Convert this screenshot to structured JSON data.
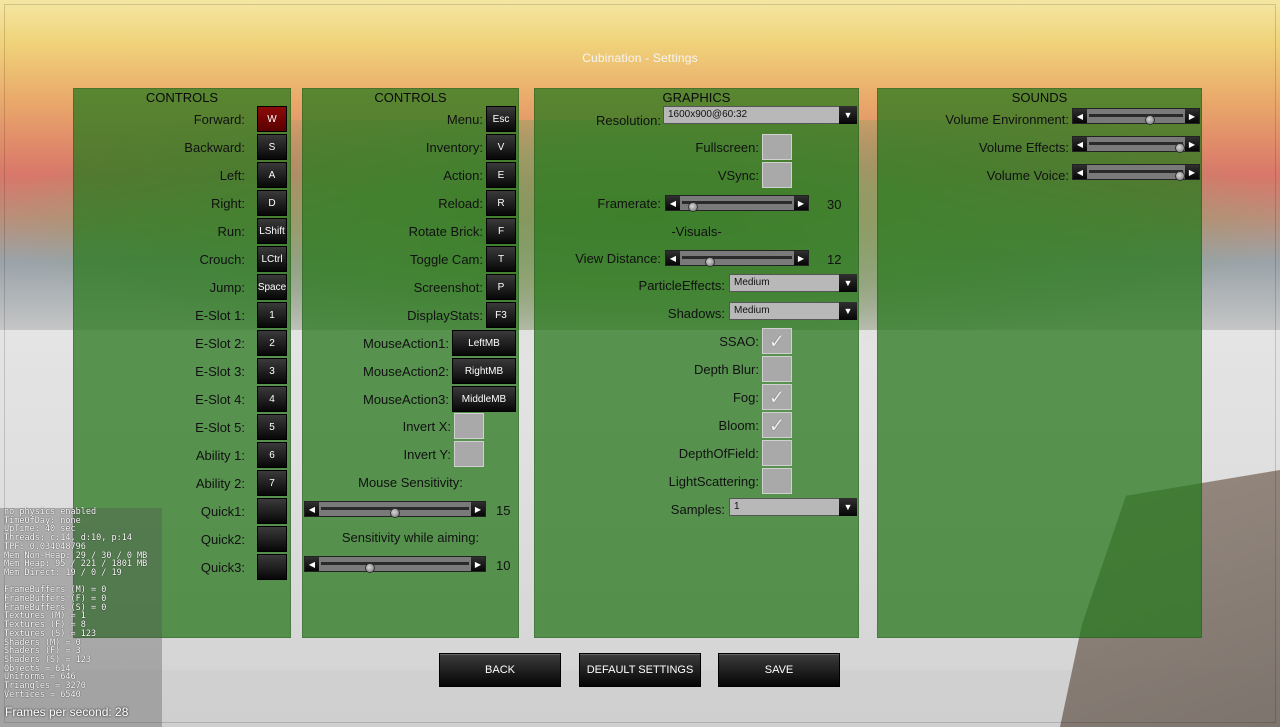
{
  "window_title": "Cubination - Settings",
  "controls1": {
    "title": "CONTROLS",
    "rows": [
      {
        "label": "Forward:",
        "key": "W",
        "active": true
      },
      {
        "label": "Backward:",
        "key": "S"
      },
      {
        "label": "Left:",
        "key": "A"
      },
      {
        "label": "Right:",
        "key": "D"
      },
      {
        "label": "Run:",
        "key": "LShift"
      },
      {
        "label": "Crouch:",
        "key": "LCtrl"
      },
      {
        "label": "Jump:",
        "key": "Space"
      },
      {
        "label": "E-Slot 1:",
        "key": "1"
      },
      {
        "label": "E-Slot 2:",
        "key": "2"
      },
      {
        "label": "E-Slot 3:",
        "key": "3"
      },
      {
        "label": "E-Slot 4:",
        "key": "4"
      },
      {
        "label": "E-Slot 5:",
        "key": "5"
      },
      {
        "label": "Ability 1:",
        "key": "6"
      },
      {
        "label": "Ability 2:",
        "key": "7"
      },
      {
        "label": "Quick1:",
        "key": ""
      },
      {
        "label": "Quick2:",
        "key": ""
      },
      {
        "label": "Quick3:",
        "key": ""
      }
    ]
  },
  "controls2": {
    "title": "CONTROLS",
    "rows": [
      {
        "label": "Menu:",
        "key": "Esc"
      },
      {
        "label": "Inventory:",
        "key": "V"
      },
      {
        "label": "Action:",
        "key": "E"
      },
      {
        "label": "Reload:",
        "key": "R"
      },
      {
        "label": "Rotate Brick:",
        "key": "F"
      },
      {
        "label": "Toggle Cam:",
        "key": "T"
      },
      {
        "label": "Screenshot:",
        "key": "P"
      },
      {
        "label": "DisplayStats:",
        "key": "F3"
      },
      {
        "label": "MouseAction1:",
        "key": "LeftMB"
      },
      {
        "label": "MouseAction2:",
        "key": "RightMB"
      },
      {
        "label": "MouseAction3:",
        "key": "MiddleMB"
      }
    ],
    "invert_x_label": "Invert X:",
    "invert_y_label": "Invert Y:",
    "mouse_sensitivity_label": "Mouse Sensitivity:",
    "mouse_sensitivity_value": "15",
    "mouse_sensitivity_fraction": 0.5,
    "aim_sensitivity_label": "Sensitivity while aiming:",
    "aim_sensitivity_value": "10",
    "aim_sensitivity_fraction": 0.33
  },
  "graphics": {
    "title": "GRAPHICS",
    "resolution_label": "Resolution:",
    "resolution_value": "1600x900@60:32",
    "fullscreen_label": "Fullscreen:",
    "vsync_label": "VSync:",
    "framerate_label": "Framerate:",
    "framerate_value": "30",
    "framerate_fraction": 0.1,
    "visuals_header": "-Visuals-",
    "view_distance_label": "View Distance:",
    "view_distance_value": "12",
    "view_distance_fraction": 0.25,
    "particle_label": "ParticleEffects:",
    "particle_value": "Medium",
    "shadows_label": "Shadows:",
    "shadows_value": "Medium",
    "ssao_label": "SSAO:",
    "depth_blur_label": "Depth Blur:",
    "fog_label": "Fog:",
    "bloom_label": "Bloom:",
    "dof_label": "DepthOfField:",
    "light_label": "LightScattering:",
    "samples_label": "Samples:",
    "samples_value": "1",
    "check_glyph": "✓"
  },
  "sounds": {
    "title": "SOUNDS",
    "env_label": "Volume Environment:",
    "env_fraction": 0.65,
    "effects_label": "Volume Effects:",
    "effects_fraction": 0.97,
    "voice_label": "Volume Voice:",
    "voice_fraction": 0.97
  },
  "buttons": {
    "back": "BACK",
    "default": "DEFAULT SETTINGS",
    "save": "SAVE"
  },
  "debug_text": "no physics enabled\nTimeOfDay: none\nUpTime: 40 sec\nThreads: c:14, d:10, p:14\nTPF: 0.034048796\nMem Non-Heap: 29 / 30 / 0 MB\nMem Heap: 95 / 221 / 1801 MB\nMem Direct: 19 / 0 / 19\n\nFrameBuffers (M) = 0\nFrameBuffers (F) = 0\nFrameBuffers (S) = 0\nTextures (M) = 1\nTextures (F) = 8\nTextures (S) = 123\nShaders (M) = 0\nShaders (F) = 3\nShaders (S) = 123\nObjects = 614\nUniforms = 646\nTriangles = 3270\nVertices = 6540",
  "fps_text": "Frames per second: 28",
  "icons": {
    "arrow_left": "◀",
    "arrow_right": "▶",
    "arrow_down": "▼"
  },
  "colors": {
    "panel_green": "#287820",
    "active_key": "#8b0a0a"
  }
}
